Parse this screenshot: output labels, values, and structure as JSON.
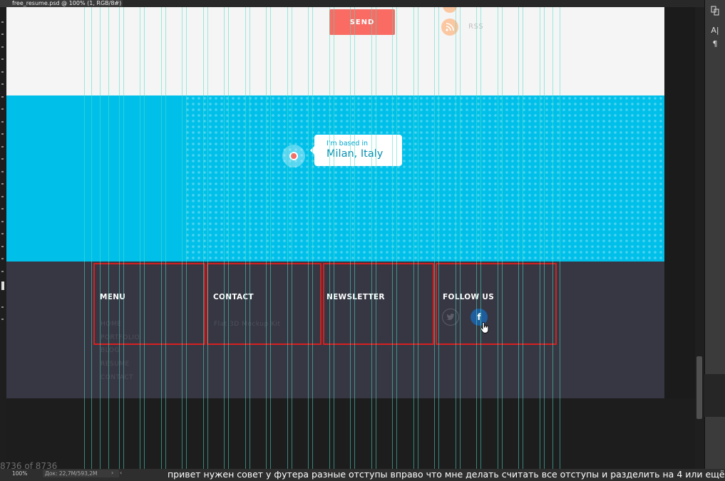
{
  "document": {
    "tab_title": "free_resume.psd @ 100% (1, RGB/8#)",
    "close_symbol": "×"
  },
  "canvas": {
    "send_label": "SEND",
    "rss_label": "RSS",
    "location_small": "I'm based in",
    "location_city": "Milan, Italy"
  },
  "footer": {
    "menu_heading": "MENU",
    "menu_items": [
      "HOME",
      "PORTFOLIO",
      "BLOG",
      "RESUME",
      "CONTACT"
    ],
    "contact_heading": "CONTACT",
    "contact_text": "Flat 3D Mockup Kit",
    "newsletter_heading": "NEWSLETTER",
    "follow_heading": "FOLLOW US",
    "twitter_icon_glyph": "🐦",
    "facebook_icon_glyph": "f"
  },
  "status": {
    "page_count": "8736 of 8736",
    "zoom": "100%",
    "doc_size": "Док: 22,7M/593,2M",
    "arrow_right": "›",
    "arrow_left": "‹"
  },
  "message": "привет нужен совет у футера разные отступы вправо что мне делать считать все отступы и разделить на 4 или ещё чтото",
  "right_panel": {
    "icon_text_a": "A|",
    "icon_pilcrow": "¶"
  },
  "colors": {
    "map_blue": "#00c0ea",
    "footer_bg": "#363743",
    "send_red": "#f96b63",
    "guide_cyan": "#4adec6",
    "highlight_red": "#d81f1f",
    "facebook_blue": "#1f5d9d"
  }
}
